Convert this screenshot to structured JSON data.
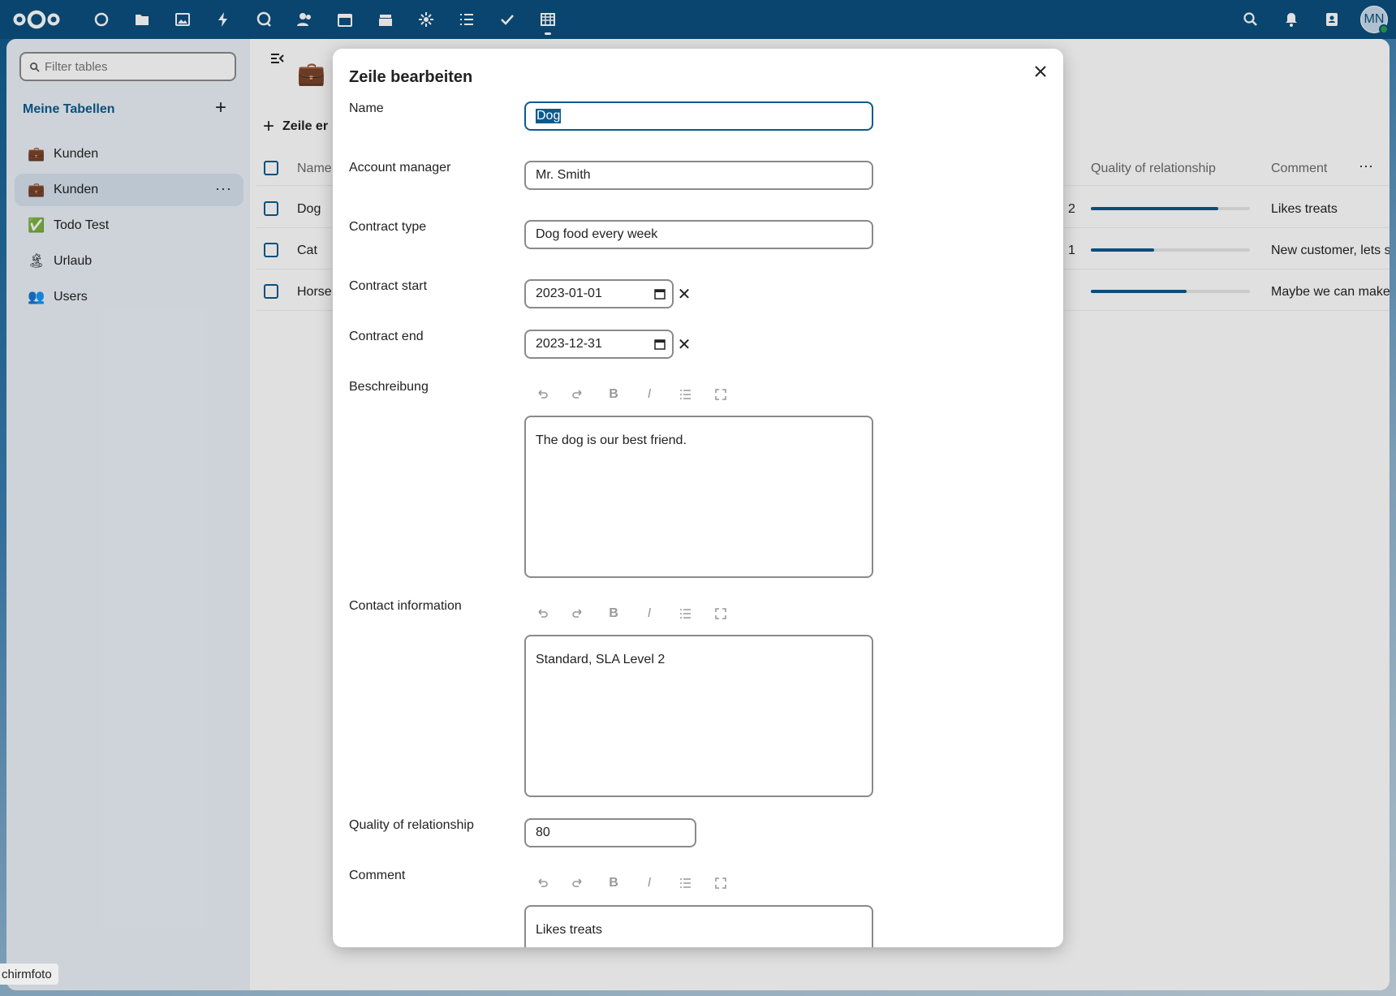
{
  "header": {
    "nav_icons": [
      "dashboard-icon",
      "files-icon",
      "photos-icon",
      "activity-icon",
      "talk-icon",
      "contacts-icon",
      "calendar-icon",
      "deck-icon",
      "ai-icon",
      "tasks-icon",
      "checkmark-icon",
      "tables-icon"
    ],
    "user_initials": "MN"
  },
  "sidebar": {
    "filter_placeholder": "Filter tables",
    "section_title": "Meine Tabellen",
    "add_label": "+",
    "items": [
      {
        "emoji": "💼",
        "label": "Kunden"
      },
      {
        "emoji": "💼",
        "label": "Kunden"
      },
      {
        "emoji": "✅",
        "label": "Todo Test"
      },
      {
        "emoji": "🏝",
        "label": "Urlaub"
      },
      {
        "emoji": "👥",
        "label": "Users"
      }
    ],
    "more_label": "···"
  },
  "table": {
    "title_emoji": "💼",
    "add_row_label": "Zeile er",
    "headers": {
      "name": "Name",
      "quality": "Quality of relationship",
      "comment": "Comment"
    },
    "more_label": "···",
    "rows": [
      {
        "name": "Dog",
        "partial": "2",
        "quality": 0.8,
        "comment": "Likes treats"
      },
      {
        "name": "Cat",
        "partial": "1",
        "quality": 0.4,
        "comment": "New customer, lets se"
      },
      {
        "name": "Horse",
        "partial": "",
        "quality": 0.6,
        "comment": "Maybe we can make it"
      }
    ]
  },
  "modal": {
    "title": "Zeile bearbeiten",
    "fields": {
      "name": {
        "label": "Name",
        "value": "Dog"
      },
      "account_manager": {
        "label": "Account manager",
        "value": "Mr. Smith"
      },
      "contract_type": {
        "label": "Contract type",
        "value": "Dog food every week"
      },
      "contract_start": {
        "label": "Contract start",
        "value": "2023-01-01"
      },
      "contract_end": {
        "label": "Contract end",
        "value": "2023-12-31"
      },
      "description": {
        "label": "Beschreibung",
        "value": "The dog is our best friend."
      },
      "contact": {
        "label": "Contact information",
        "value": "Standard, SLA Level 2"
      },
      "quality": {
        "label": "Quality of relationship",
        "value": "80"
      },
      "comment": {
        "label": "Comment",
        "value": "Likes treats"
      }
    },
    "clear_label": "✕"
  },
  "tooltip": "chirmfoto"
}
